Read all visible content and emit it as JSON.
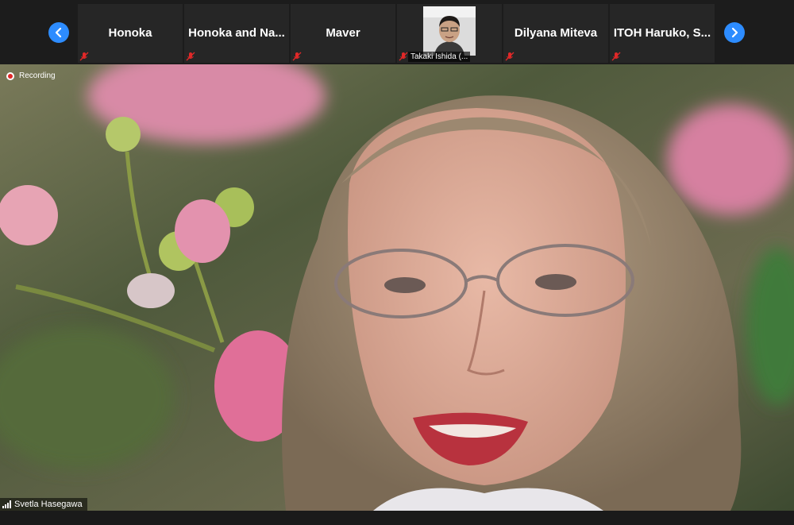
{
  "participants": [
    {
      "name": "Honoka",
      "muted": true,
      "video": false
    },
    {
      "name": "Honoka and Na...",
      "muted": true,
      "video": false
    },
    {
      "name": "Maver",
      "muted": true,
      "video": false
    },
    {
      "name": "Takaki Ishida (...",
      "muted": true,
      "video": true
    },
    {
      "name": "Dilyana Miteva",
      "muted": true,
      "video": false
    },
    {
      "name": "ITOH Haruko, S...",
      "muted": true,
      "video": false
    }
  ],
  "recording_label": "Recording",
  "active_speaker": "Svetla Hasegawa",
  "icons": {
    "prev": "chevron-left-icon",
    "next": "chevron-right-icon",
    "mic": "mic-muted-icon",
    "record": "record-icon",
    "signal": "signal-icon"
  },
  "colors": {
    "accent": "#2d8cff",
    "muted": "#e02828",
    "bar": "#1c1c1c"
  }
}
